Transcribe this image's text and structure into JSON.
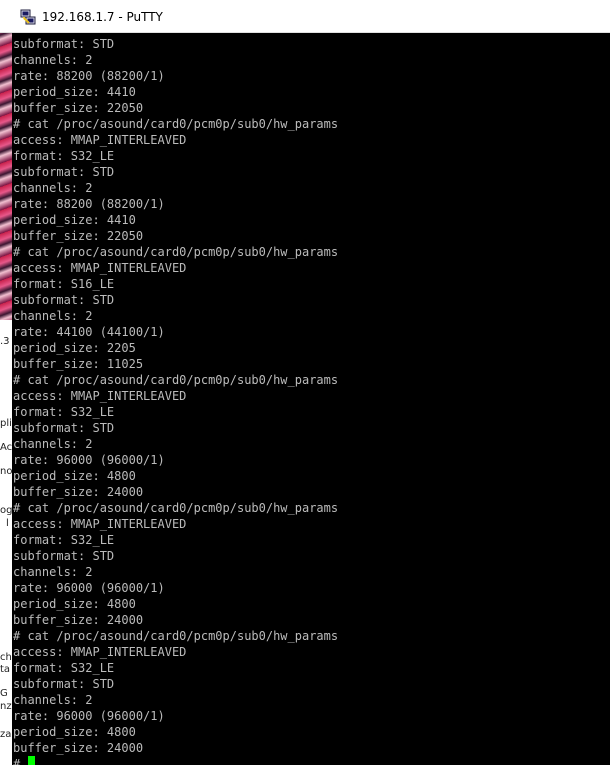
{
  "window": {
    "title": "192.168.1.7 - PuTTY",
    "app_icon": "putty-icon"
  },
  "background_window": {
    "fragments": [
      ".3",
      "pli",
      "Ac",
      "no",
      "ogr",
      "l",
      "ch",
      "ta",
      "G",
      "nz",
      "za"
    ]
  },
  "terminal": {
    "lines": [
      "subformat: STD",
      "channels: 2",
      "rate: 88200 (88200/1)",
      "period_size: 4410",
      "buffer_size: 22050",
      "# cat /proc/asound/card0/pcm0p/sub0/hw_params",
      "access: MMAP_INTERLEAVED",
      "format: S32_LE",
      "subformat: STD",
      "channels: 2",
      "rate: 88200 (88200/1)",
      "period_size: 4410",
      "buffer_size: 22050",
      "# cat /proc/asound/card0/pcm0p/sub0/hw_params",
      "access: MMAP_INTERLEAVED",
      "format: S16_LE",
      "subformat: STD",
      "channels: 2",
      "rate: 44100 (44100/1)",
      "period_size: 2205",
      "buffer_size: 11025",
      "# cat /proc/asound/card0/pcm0p/sub0/hw_params",
      "access: MMAP_INTERLEAVED",
      "format: S32_LE",
      "subformat: STD",
      "channels: 2",
      "rate: 96000 (96000/1)",
      "period_size: 4800",
      "buffer_size: 24000",
      "# cat /proc/asound/card0/pcm0p/sub0/hw_params",
      "access: MMAP_INTERLEAVED",
      "format: S32_LE",
      "subformat: STD",
      "channels: 2",
      "rate: 96000 (96000/1)",
      "period_size: 4800",
      "buffer_size: 24000",
      "# cat /proc/asound/card0/pcm0p/sub0/hw_params",
      "access: MMAP_INTERLEAVED",
      "format: S32_LE",
      "subformat: STD",
      "channels: 2",
      "rate: 96000 (96000/1)",
      "period_size: 4800",
      "buffer_size: 24000"
    ],
    "prompt": "#",
    "colors": {
      "background": "#000000",
      "foreground": "#bbbbbb",
      "cursor": "#00ff00"
    }
  }
}
